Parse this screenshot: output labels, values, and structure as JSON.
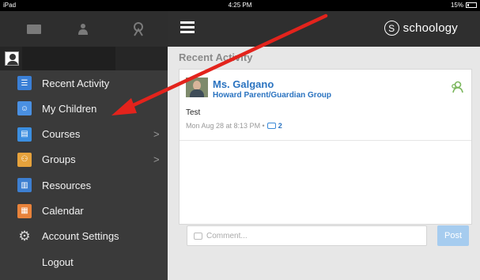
{
  "status_bar": {
    "device": "iPad",
    "time": "4:25 PM",
    "battery": "15%"
  },
  "sidebar": {
    "tabs": [
      {
        "icon": "envelope-icon"
      },
      {
        "icon": "people-icon"
      },
      {
        "icon": "notification-icon"
      }
    ],
    "profile": {
      "icon": "avatar-icon",
      "name": ""
    },
    "items": [
      {
        "label": "Recent Activity",
        "icon": "recent-activity-icon",
        "color": "#3a7fd6",
        "submenu": false
      },
      {
        "label": "My Children",
        "icon": "children-icon",
        "color": "#4a90e2",
        "submenu": false
      },
      {
        "label": "Courses",
        "icon": "courses-icon",
        "color": "#3b8ee0",
        "submenu": true
      },
      {
        "label": "Groups",
        "icon": "groups-icon",
        "color": "#e6a23c",
        "submenu": true
      },
      {
        "label": "Resources",
        "icon": "resources-icon",
        "color": "#3d7fd1",
        "submenu": false
      },
      {
        "label": "Calendar",
        "icon": "calendar-icon",
        "color": "#e8823a",
        "submenu": false
      },
      {
        "label": "Account Settings",
        "icon": "gear-icon",
        "color": "#d8d8d8",
        "submenu": false
      },
      {
        "label": "Logout",
        "icon": "",
        "color": "",
        "submenu": false
      }
    ],
    "submenu_glyph": ">"
  },
  "header": {
    "menu_icon": "hamburger-icon",
    "brand_icon_glyph": "S",
    "brand": "schoology"
  },
  "main": {
    "section_title": "Recent Activity",
    "post": {
      "author": "Ms. Galgano",
      "group": "Howard Parent/Guardian Group",
      "body": "Test",
      "timestamp": "Mon Aug 28 at 8:13 PM •",
      "comment_count": "2"
    },
    "comment_placeholder": "Comment...",
    "post_button": "Post"
  },
  "colors": {
    "accent": "#2a73c0",
    "sidebar_bg": "#3a3a3a",
    "header_bg": "#2f2f2f",
    "arrow": "#e3231c"
  }
}
